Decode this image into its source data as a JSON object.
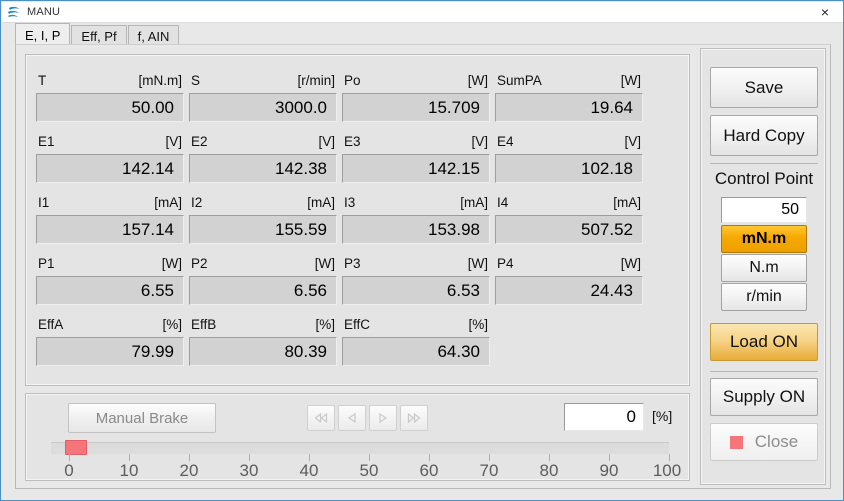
{
  "window": {
    "title": "MANU",
    "logo_icon": "swirl-logo-icon",
    "close_glyph": "×"
  },
  "tabs": [
    {
      "label": "E, I, P",
      "active": true
    },
    {
      "label": "Eff, Pf",
      "active": false
    },
    {
      "label": "f, AIN",
      "active": false
    }
  ],
  "readouts": {
    "rows": [
      [
        {
          "name": "T",
          "unit": "[mN.m]",
          "value": "50.00"
        },
        {
          "name": "S",
          "unit": "[r/min]",
          "value": "3000.0"
        },
        {
          "name": "Po",
          "unit": "[W]",
          "value": "15.709"
        },
        {
          "name": "SumPA",
          "unit": "[W]",
          "value": "19.64"
        }
      ],
      [
        {
          "name": "E1",
          "unit": "[V]",
          "value": "142.14"
        },
        {
          "name": "E2",
          "unit": "[V]",
          "value": "142.38"
        },
        {
          "name": "E3",
          "unit": "[V]",
          "value": "142.15"
        },
        {
          "name": "E4",
          "unit": "[V]",
          "value": "102.18"
        }
      ],
      [
        {
          "name": "I1",
          "unit": "[mA]",
          "value": "157.14"
        },
        {
          "name": "I2",
          "unit": "[mA]",
          "value": "155.59"
        },
        {
          "name": "I3",
          "unit": "[mA]",
          "value": "153.98"
        },
        {
          "name": "I4",
          "unit": "[mA]",
          "value": "507.52"
        }
      ],
      [
        {
          "name": "P1",
          "unit": "[W]",
          "value": "6.55"
        },
        {
          "name": "P2",
          "unit": "[W]",
          "value": "6.56"
        },
        {
          "name": "P3",
          "unit": "[W]",
          "value": "6.53"
        },
        {
          "name": "P4",
          "unit": "[W]",
          "value": "24.43"
        }
      ],
      [
        {
          "name": "EffA",
          "unit": "[%]",
          "value": "79.99"
        },
        {
          "name": "EffB",
          "unit": "[%]",
          "value": "80.39"
        },
        {
          "name": "EffC",
          "unit": "[%]",
          "value": "64.30"
        }
      ]
    ]
  },
  "bottom": {
    "manual_brake_label": "Manual Brake",
    "nav_buttons": [
      {
        "icon": "skip-backward-icon",
        "enabled": false
      },
      {
        "icon": "step-backward-icon",
        "enabled": false
      },
      {
        "icon": "step-forward-icon",
        "enabled": false
      },
      {
        "icon": "skip-forward-icon",
        "enabled": false
      }
    ],
    "percent_value": "0",
    "percent_unit": "[%]",
    "slider": {
      "value": 0,
      "min": 0,
      "max": 100,
      "ticks": [
        "0",
        "10",
        "20",
        "30",
        "40",
        "50",
        "60",
        "70",
        "80",
        "90",
        "100"
      ],
      "thumb_color": "#f4767a"
    }
  },
  "right_panel": {
    "save_label": "Save",
    "hard_copy_label": "Hard Copy",
    "control_point_title": "Control Point",
    "control_point_value": "50",
    "unit_options": [
      {
        "label": "mN.m",
        "selected": true
      },
      {
        "label": "N.m",
        "selected": false
      },
      {
        "label": "r/min",
        "selected": false
      }
    ],
    "load_label": "Load ON",
    "supply_label": "Supply ON",
    "close_label": "Close",
    "close_led_color": "#f4767a",
    "accent_selected": "#f5a800",
    "accent_load": "#e9ac38"
  }
}
